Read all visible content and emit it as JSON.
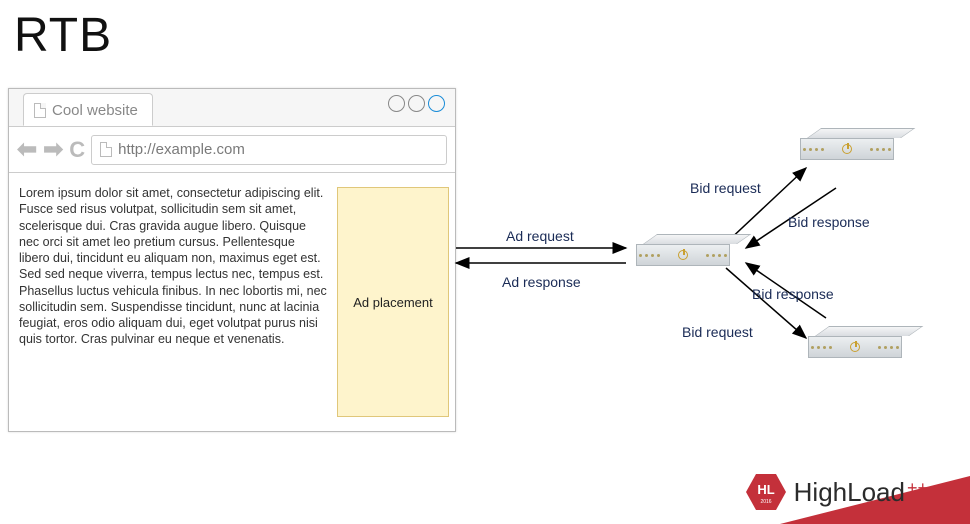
{
  "title": "RTB",
  "browser": {
    "tab_title": "Cool website",
    "url": "http://example.com",
    "lorem": "Lorem ipsum dolor sit amet, consectetur adipiscing elit. Fusce sed risus volutpat, sollicitudin sem sit amet, scelerisque dui. Cras gravida augue libero. Quisque nec orci sit amet leo pretium cursus. Pellentesque libero dui, tincidunt eu aliquam non, maximus eget est. Sed sed neque viverra, tempus lectus nec, tempus est. Phasellus luctus vehicula finibus. In nec lobortis mi, nec sollicitudin sem. Suspendisse tincidunt, nunc at lacinia feugiat, eros odio aliquam dui, eget volutpat purus nisi quis tortor. Cras pulvinar eu neque et venenatis.",
    "ad_label": "Ad placement"
  },
  "labels": {
    "ad_request": "Ad request",
    "ad_response": "Ad response",
    "bid_request_top": "Bid request",
    "bid_response_top": "Bid response",
    "bid_request_bottom": "Bid request",
    "bid_response_bottom": "Bid response"
  },
  "footer": {
    "brand": "HighLoad",
    "hl": "HL",
    "year": "2016"
  }
}
